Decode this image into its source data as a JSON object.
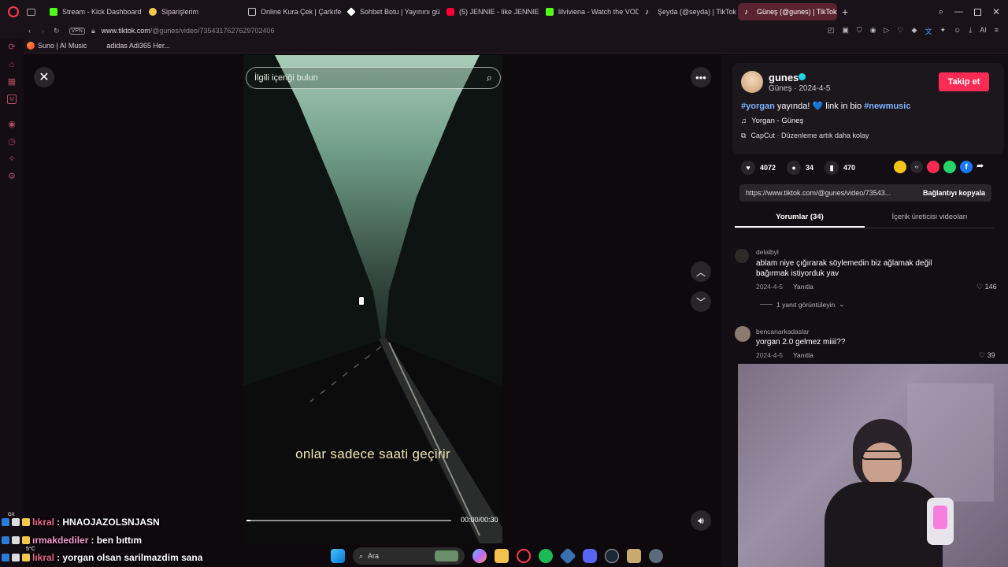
{
  "tabs": [
    {
      "label": "Stream - Kick Dashboard",
      "color": "#53fc18"
    },
    {
      "label": "Siparişlerim",
      "color": "#f2c94c"
    },
    {
      "label": "Online Kura Çek | Çarkıfelek",
      "color": "#ffffff"
    },
    {
      "label": "Sohbet Botu | Yayınını güç",
      "color": "#ffffff"
    },
    {
      "label": "(5) JENNIE - like JENNIE",
      "color": "#ff0033"
    },
    {
      "label": "lilviviena - Watch the VOD",
      "color": "#53fc18"
    },
    {
      "label": "Şeyda (@seyda) | TikTok",
      "color": "#ffffff"
    },
    {
      "label": "Güneş (@gunes) | TikTok",
      "color": "#ffffff"
    }
  ],
  "address": {
    "vpn": "VPN",
    "url_prefix": "www.tiktok.com",
    "url_rest": "/@gunes/video/7354317627629702406"
  },
  "bookmarks": [
    {
      "label": "Suno | AI Music"
    },
    {
      "label": "adidas Adi365 Her..."
    }
  ],
  "video": {
    "search_placeholder": "İlgili içeriği bulun",
    "caption": "onlar sadece saati geçirir",
    "time": "00:00/00:30",
    "progress": 0.02
  },
  "profile": {
    "username": "gunes",
    "display_name": "Güneş",
    "date": "2024-4-5",
    "follow_label": "Takip et",
    "description_tag1": "#yorgan",
    "description_mid": " yayında! 💙 link in bio ",
    "description_tag2": "#newmusic",
    "music": "Yorgan - Güneş",
    "capcut": "CapCut · Düzenleme artık daha kolay"
  },
  "stats": {
    "likes": "4072",
    "comments": "34",
    "saves": "470"
  },
  "share": {
    "link": "https://www.tiktok.com/@gunes/video/73543...",
    "copy_label": "Bağlantıyı kopyala"
  },
  "comment_tabs": {
    "comments": "Yorumlar (34)",
    "creator_videos": "İçerik üreticisi videoları"
  },
  "comments": [
    {
      "user": "delalbyl",
      "text": "ablam niye çığırarak söylemedin biz ağlamak değil bağırmak istiyorduk yav",
      "date": "2024-4-5",
      "reply": "Yanıtla",
      "likes": "146",
      "more_replies": "1 yanıt görüntüleyin"
    },
    {
      "user": "bencanarkadaslar",
      "text": "yorgan 2.0 gelmez miiii??",
      "date": "2024-4-5",
      "reply": "Yanıtla",
      "likes": "39"
    }
  ],
  "chat": [
    {
      "user": "lıkral",
      "user_color": "#e86a8a",
      "message": ": HNAOJAZOLSNJASN"
    },
    {
      "user": "ırmakdediler",
      "user_color": "#f29ad1",
      "message": ": ben bıttım"
    },
    {
      "user": "lıkral",
      "user_color": "#e86a8a",
      "message": ": yorgan olsan sarilmazdim sana"
    }
  ],
  "taskbar": {
    "search": "Ara",
    "weather": "5°C"
  },
  "colors": {
    "accent": "#fe2c55",
    "hashtag": "#7fb4ff",
    "tab_active": "#5a2330"
  }
}
